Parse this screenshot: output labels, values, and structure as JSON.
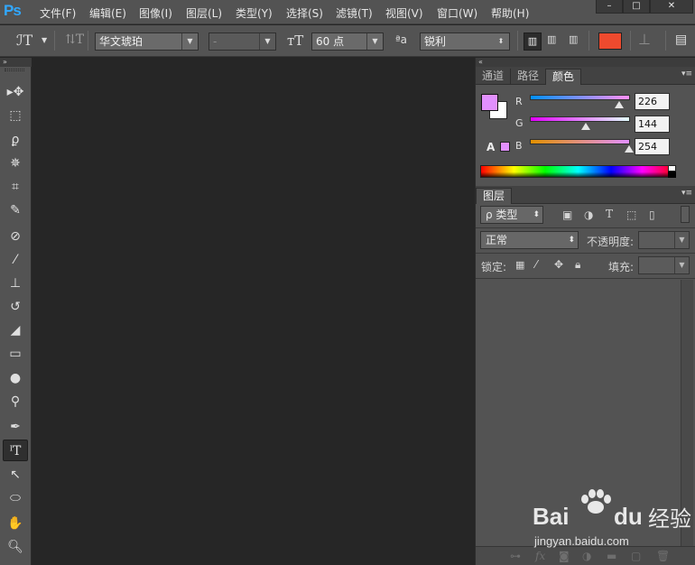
{
  "app": {
    "logo": "Ps"
  },
  "menu": [
    "文件(F)",
    "编辑(E)",
    "图像(I)",
    "图层(L)",
    "类型(Y)",
    "选择(S)",
    "滤镜(T)",
    "视图(V)",
    "窗口(W)",
    "帮助(H)"
  ],
  "window_controls": {
    "minimize": "–",
    "maximize": "□",
    "close": "✕"
  },
  "options": {
    "tool_glyph": "ℐT",
    "font_family": "华文琥珀",
    "font_style": "-",
    "font_size": "60 点",
    "aa_prefix": "ªa",
    "anti_alias": "锐利",
    "text_color": "#ee4a2e"
  },
  "tools": [
    "move-tool",
    "marquee-tool",
    "lasso-tool",
    "magic-wand-tool",
    "crop-tool",
    "eyedropper-tool",
    "healing-brush-tool",
    "brush-tool",
    "clone-stamp-tool",
    "history-brush-tool",
    "eraser-tool",
    "gradient-tool",
    "blur-tool",
    "dodge-tool",
    "pen-tool",
    "type-tool",
    "path-selection-tool",
    "ellipse-tool",
    "hand-tool",
    "zoom-tool"
  ],
  "panels": {
    "top_tabs": [
      "通道",
      "路径",
      "颜色"
    ],
    "active_tab": "颜色",
    "color": {
      "foreground": "#e290fe",
      "background": "#ffffff",
      "channels": [
        {
          "label": "R",
          "value": "226"
        },
        {
          "label": "G",
          "value": "144"
        },
        {
          "label": "B",
          "value": "254"
        }
      ],
      "warning_glyph": "A"
    },
    "layers": {
      "tab": "图层",
      "filter": "ρ 类型",
      "blend_mode": "正常",
      "opacity_label": "不透明度:",
      "lock_label": "锁定:",
      "fill_label": "填充:"
    }
  },
  "watermark": {
    "brand": "Bai",
    "brand2": "du",
    "cn": "经验",
    "url": "jingyan.baidu.com"
  }
}
